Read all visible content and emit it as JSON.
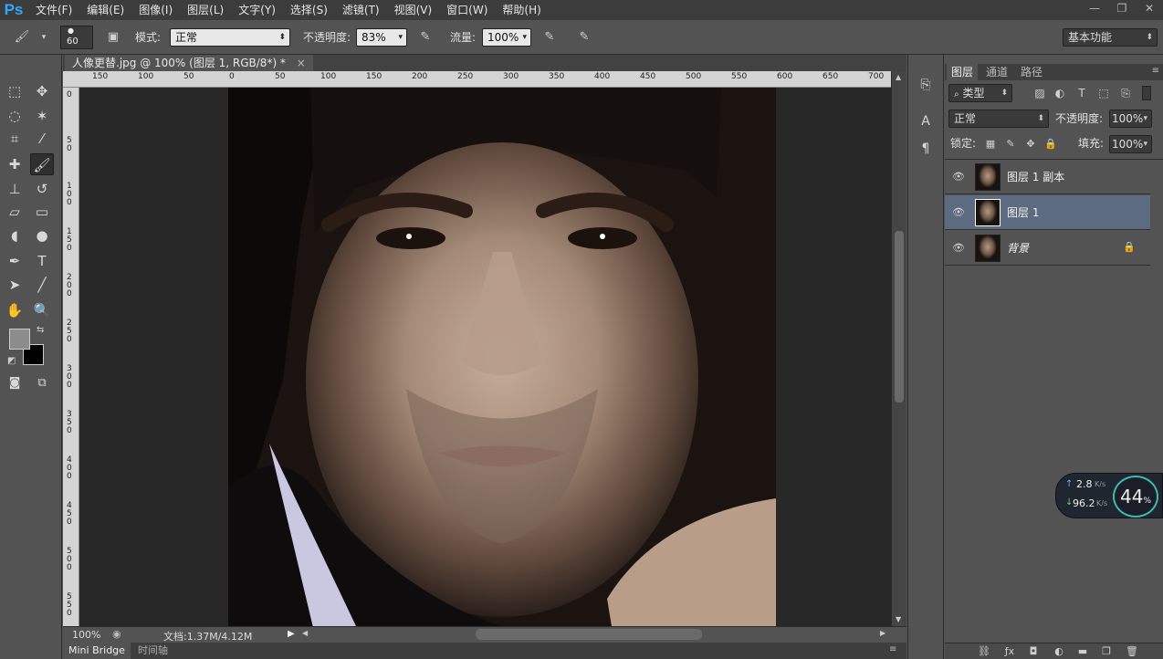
{
  "app": {
    "logo": "Ps"
  },
  "menu": [
    "文件(F)",
    "编辑(E)",
    "图像(I)",
    "图层(L)",
    "文字(Y)",
    "选择(S)",
    "滤镜(T)",
    "视图(V)",
    "窗口(W)",
    "帮助(H)"
  ],
  "window_buttons": {
    "minimize": "—",
    "restore": "❐",
    "close": "✕"
  },
  "options": {
    "brush_size": "60",
    "mode_label": "模式:",
    "mode_value": "正常",
    "opacity_label": "不透明度:",
    "opacity_value": "83%",
    "flow_label": "流量:",
    "flow_value": "100%",
    "workspace": "基本功能"
  },
  "document": {
    "tab_title": "人像更替.jpg @ 100% (图层 1, RGB/8*) *",
    "tab_close": "×",
    "ruler_top_labels": [
      "150",
      "100",
      "50",
      "0",
      "50",
      "100",
      "150",
      "200",
      "250",
      "300",
      "350",
      "400",
      "450",
      "500",
      "550",
      "600",
      "650",
      "700"
    ],
    "ruler_left_labels": [
      "0",
      "5 0",
      "1 0 0",
      "1 5 0",
      "2 0 0",
      "2 5 0",
      "3 0 0",
      "3 5 0",
      "4 0 0",
      "4 5 0",
      "5 0 0",
      "5 5 0"
    ],
    "zoom": "100%",
    "doc_info": "文档:1.37M/4.12M"
  },
  "bottom_tabs": {
    "mini_bridge": "Mini Bridge",
    "timeline": "时间轴"
  },
  "layers_panel": {
    "tabs": [
      "图层",
      "通道",
      "路径"
    ],
    "filter_kind": "类型",
    "blend_mode": "正常",
    "opacity_label": "不透明度:",
    "opacity_value": "100%",
    "lock_label": "锁定:",
    "fill_label": "填充:",
    "fill_value": "100%",
    "layers": [
      {
        "name": "图层 1 副本",
        "selected": false,
        "locked": false
      },
      {
        "name": "图层 1",
        "selected": true,
        "locked": false
      },
      {
        "name": "背景",
        "selected": false,
        "locked": true
      }
    ]
  },
  "net_widget": {
    "upload": "2.8",
    "download": "96.2",
    "unit": "K/s",
    "cpu": "44",
    "cpu_unit": "%"
  }
}
